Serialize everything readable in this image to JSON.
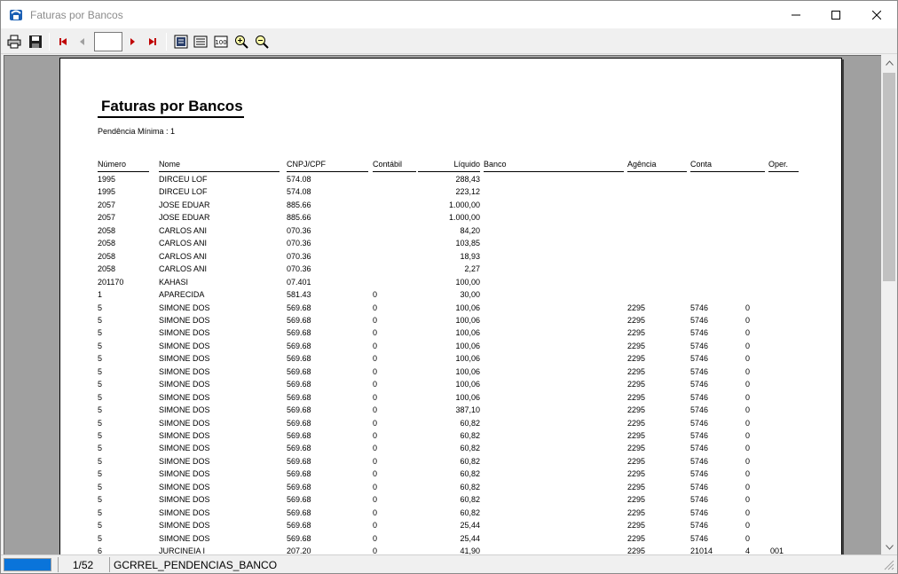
{
  "window": {
    "title": "Faturas por Bancos"
  },
  "toolbar": {
    "page_value": ""
  },
  "report": {
    "title": "Faturas por Bancos",
    "pendencia": "Pendência Mínima : 1",
    "columns": {
      "numero": "Número",
      "nome": "Nome",
      "cnpj": "CNPJ/CPF",
      "contabil": "Contábil",
      "liquido": "Líquido",
      "banco": "Banco",
      "agencia": "Agência",
      "conta": "Conta",
      "oper": "Oper."
    },
    "rows": [
      {
        "numero": "1995",
        "nome": "DIRCEU LOF",
        "cnpj": "574.08",
        "contabil": "",
        "liquido": "288,43",
        "agencia": "",
        "conta": "",
        "dv": "",
        "oper": ""
      },
      {
        "numero": "1995",
        "nome": "DIRCEU LOF",
        "cnpj": "574.08",
        "contabil": "",
        "liquido": "223,12",
        "agencia": "",
        "conta": "",
        "dv": "",
        "oper": ""
      },
      {
        "numero": "2057",
        "nome": "JOSE EDUAR",
        "cnpj": "885.66",
        "contabil": "",
        "liquido": "1.000,00",
        "agencia": "",
        "conta": "",
        "dv": "",
        "oper": ""
      },
      {
        "numero": "2057",
        "nome": "JOSE EDUAR",
        "cnpj": "885.66",
        "contabil": "",
        "liquido": "1.000,00",
        "agencia": "",
        "conta": "",
        "dv": "",
        "oper": ""
      },
      {
        "numero": "2058",
        "nome": "CARLOS ANI",
        "cnpj": "070.36",
        "contabil": "",
        "liquido": "84,20",
        "agencia": "",
        "conta": "",
        "dv": "",
        "oper": ""
      },
      {
        "numero": "2058",
        "nome": "CARLOS ANI",
        "cnpj": "070.36",
        "contabil": "",
        "liquido": "103,85",
        "agencia": "",
        "conta": "",
        "dv": "",
        "oper": ""
      },
      {
        "numero": "2058",
        "nome": "CARLOS ANI",
        "cnpj": "070.36",
        "contabil": "",
        "liquido": "18,93",
        "agencia": "",
        "conta": "",
        "dv": "",
        "oper": ""
      },
      {
        "numero": "2058",
        "nome": "CARLOS ANI",
        "cnpj": "070.36",
        "contabil": "",
        "liquido": "2,27",
        "agencia": "",
        "conta": "",
        "dv": "",
        "oper": ""
      },
      {
        "numero": "201170",
        "nome": "KAHASI",
        "cnpj": "07.401",
        "contabil": "",
        "liquido": "100,00",
        "agencia": "",
        "conta": "",
        "dv": "",
        "oper": ""
      },
      {
        "numero": "1",
        "nome": "APARECIDA",
        "cnpj": "581.43",
        "contabil": "0",
        "liquido": "30,00",
        "agencia": "",
        "conta": "",
        "dv": "",
        "oper": ""
      },
      {
        "numero": "5",
        "nome": "SIMONE DOS",
        "cnpj": "569.68",
        "contabil": "0",
        "liquido": "100,06",
        "agencia": "2295",
        "conta": "5746",
        "dv": "0",
        "oper": ""
      },
      {
        "numero": "5",
        "nome": "SIMONE DOS",
        "cnpj": "569.68",
        "contabil": "0",
        "liquido": "100,06",
        "agencia": "2295",
        "conta": "5746",
        "dv": "0",
        "oper": ""
      },
      {
        "numero": "5",
        "nome": "SIMONE DOS",
        "cnpj": "569.68",
        "contabil": "0",
        "liquido": "100,06",
        "agencia": "2295",
        "conta": "5746",
        "dv": "0",
        "oper": ""
      },
      {
        "numero": "5",
        "nome": "SIMONE DOS",
        "cnpj": "569.68",
        "contabil": "0",
        "liquido": "100,06",
        "agencia": "2295",
        "conta": "5746",
        "dv": "0",
        "oper": ""
      },
      {
        "numero": "5",
        "nome": "SIMONE DOS",
        "cnpj": "569.68",
        "contabil": "0",
        "liquido": "100,06",
        "agencia": "2295",
        "conta": "5746",
        "dv": "0",
        "oper": ""
      },
      {
        "numero": "5",
        "nome": "SIMONE DOS",
        "cnpj": "569.68",
        "contabil": "0",
        "liquido": "100,06",
        "agencia": "2295",
        "conta": "5746",
        "dv": "0",
        "oper": ""
      },
      {
        "numero": "5",
        "nome": "SIMONE DOS",
        "cnpj": "569.68",
        "contabil": "0",
        "liquido": "100,06",
        "agencia": "2295",
        "conta": "5746",
        "dv": "0",
        "oper": ""
      },
      {
        "numero": "5",
        "nome": "SIMONE DOS",
        "cnpj": "569.68",
        "contabil": "0",
        "liquido": "100,06",
        "agencia": "2295",
        "conta": "5746",
        "dv": "0",
        "oper": ""
      },
      {
        "numero": "5",
        "nome": "SIMONE DOS",
        "cnpj": "569.68",
        "contabil": "0",
        "liquido": "387,10",
        "agencia": "2295",
        "conta": "5746",
        "dv": "0",
        "oper": ""
      },
      {
        "numero": "5",
        "nome": "SIMONE DOS",
        "cnpj": "569.68",
        "contabil": "0",
        "liquido": "60,82",
        "agencia": "2295",
        "conta": "5746",
        "dv": "0",
        "oper": ""
      },
      {
        "numero": "5",
        "nome": "SIMONE DOS",
        "cnpj": "569.68",
        "contabil": "0",
        "liquido": "60,82",
        "agencia": "2295",
        "conta": "5746",
        "dv": "0",
        "oper": ""
      },
      {
        "numero": "5",
        "nome": "SIMONE DOS",
        "cnpj": "569.68",
        "contabil": "0",
        "liquido": "60,82",
        "agencia": "2295",
        "conta": "5746",
        "dv": "0",
        "oper": ""
      },
      {
        "numero": "5",
        "nome": "SIMONE DOS",
        "cnpj": "569.68",
        "contabil": "0",
        "liquido": "60,82",
        "agencia": "2295",
        "conta": "5746",
        "dv": "0",
        "oper": ""
      },
      {
        "numero": "5",
        "nome": "SIMONE DOS",
        "cnpj": "569.68",
        "contabil": "0",
        "liquido": "60,82",
        "agencia": "2295",
        "conta": "5746",
        "dv": "0",
        "oper": ""
      },
      {
        "numero": "5",
        "nome": "SIMONE DOS",
        "cnpj": "569.68",
        "contabil": "0",
        "liquido": "60,82",
        "agencia": "2295",
        "conta": "5746",
        "dv": "0",
        "oper": ""
      },
      {
        "numero": "5",
        "nome": "SIMONE DOS",
        "cnpj": "569.68",
        "contabil": "0",
        "liquido": "60,82",
        "agencia": "2295",
        "conta": "5746",
        "dv": "0",
        "oper": ""
      },
      {
        "numero": "5",
        "nome": "SIMONE DOS",
        "cnpj": "569.68",
        "contabil": "0",
        "liquido": "60,82",
        "agencia": "2295",
        "conta": "5746",
        "dv": "0",
        "oper": ""
      },
      {
        "numero": "5",
        "nome": "SIMONE DOS",
        "cnpj": "569.68",
        "contabil": "0",
        "liquido": "25,44",
        "agencia": "2295",
        "conta": "5746",
        "dv": "0",
        "oper": ""
      },
      {
        "numero": "5",
        "nome": "SIMONE DOS",
        "cnpj": "569.68",
        "contabil": "0",
        "liquido": "25,44",
        "agencia": "2295",
        "conta": "5746",
        "dv": "0",
        "oper": ""
      },
      {
        "numero": "6",
        "nome": "JURCINEIA I",
        "cnpj": "207.20",
        "contabil": "0",
        "liquido": "41,90",
        "agencia": "2295",
        "conta": "21014",
        "dv": "4",
        "oper": "001"
      }
    ]
  },
  "status": {
    "page": "1/52",
    "report_name": "GCRREL_PENDENCIAS_BANCO"
  }
}
